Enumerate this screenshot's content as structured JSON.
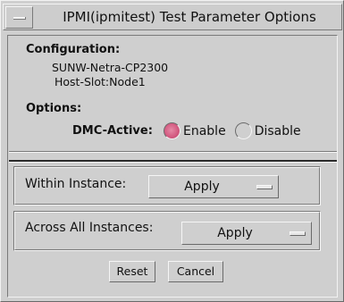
{
  "window": {
    "title": "IPMI(ipmitest) Test Parameter Options"
  },
  "configuration": {
    "heading": "Configuration:",
    "platform": "SUNW-Netra-CP2300",
    "host_slot": "Host-Slot:Node1"
  },
  "options": {
    "heading": "Options:",
    "dmc_active_label": "DMC-Active:",
    "enable_label": "Enable",
    "disable_label": "Disable",
    "selected": "Enable",
    "selected_color": "#d45c82"
  },
  "within_instance": {
    "label": "Within Instance:",
    "value": "Apply"
  },
  "across_all_instances": {
    "label": "Across All Instances:",
    "value": "Apply"
  },
  "buttons": {
    "reset": "Reset",
    "cancel": "Cancel"
  }
}
